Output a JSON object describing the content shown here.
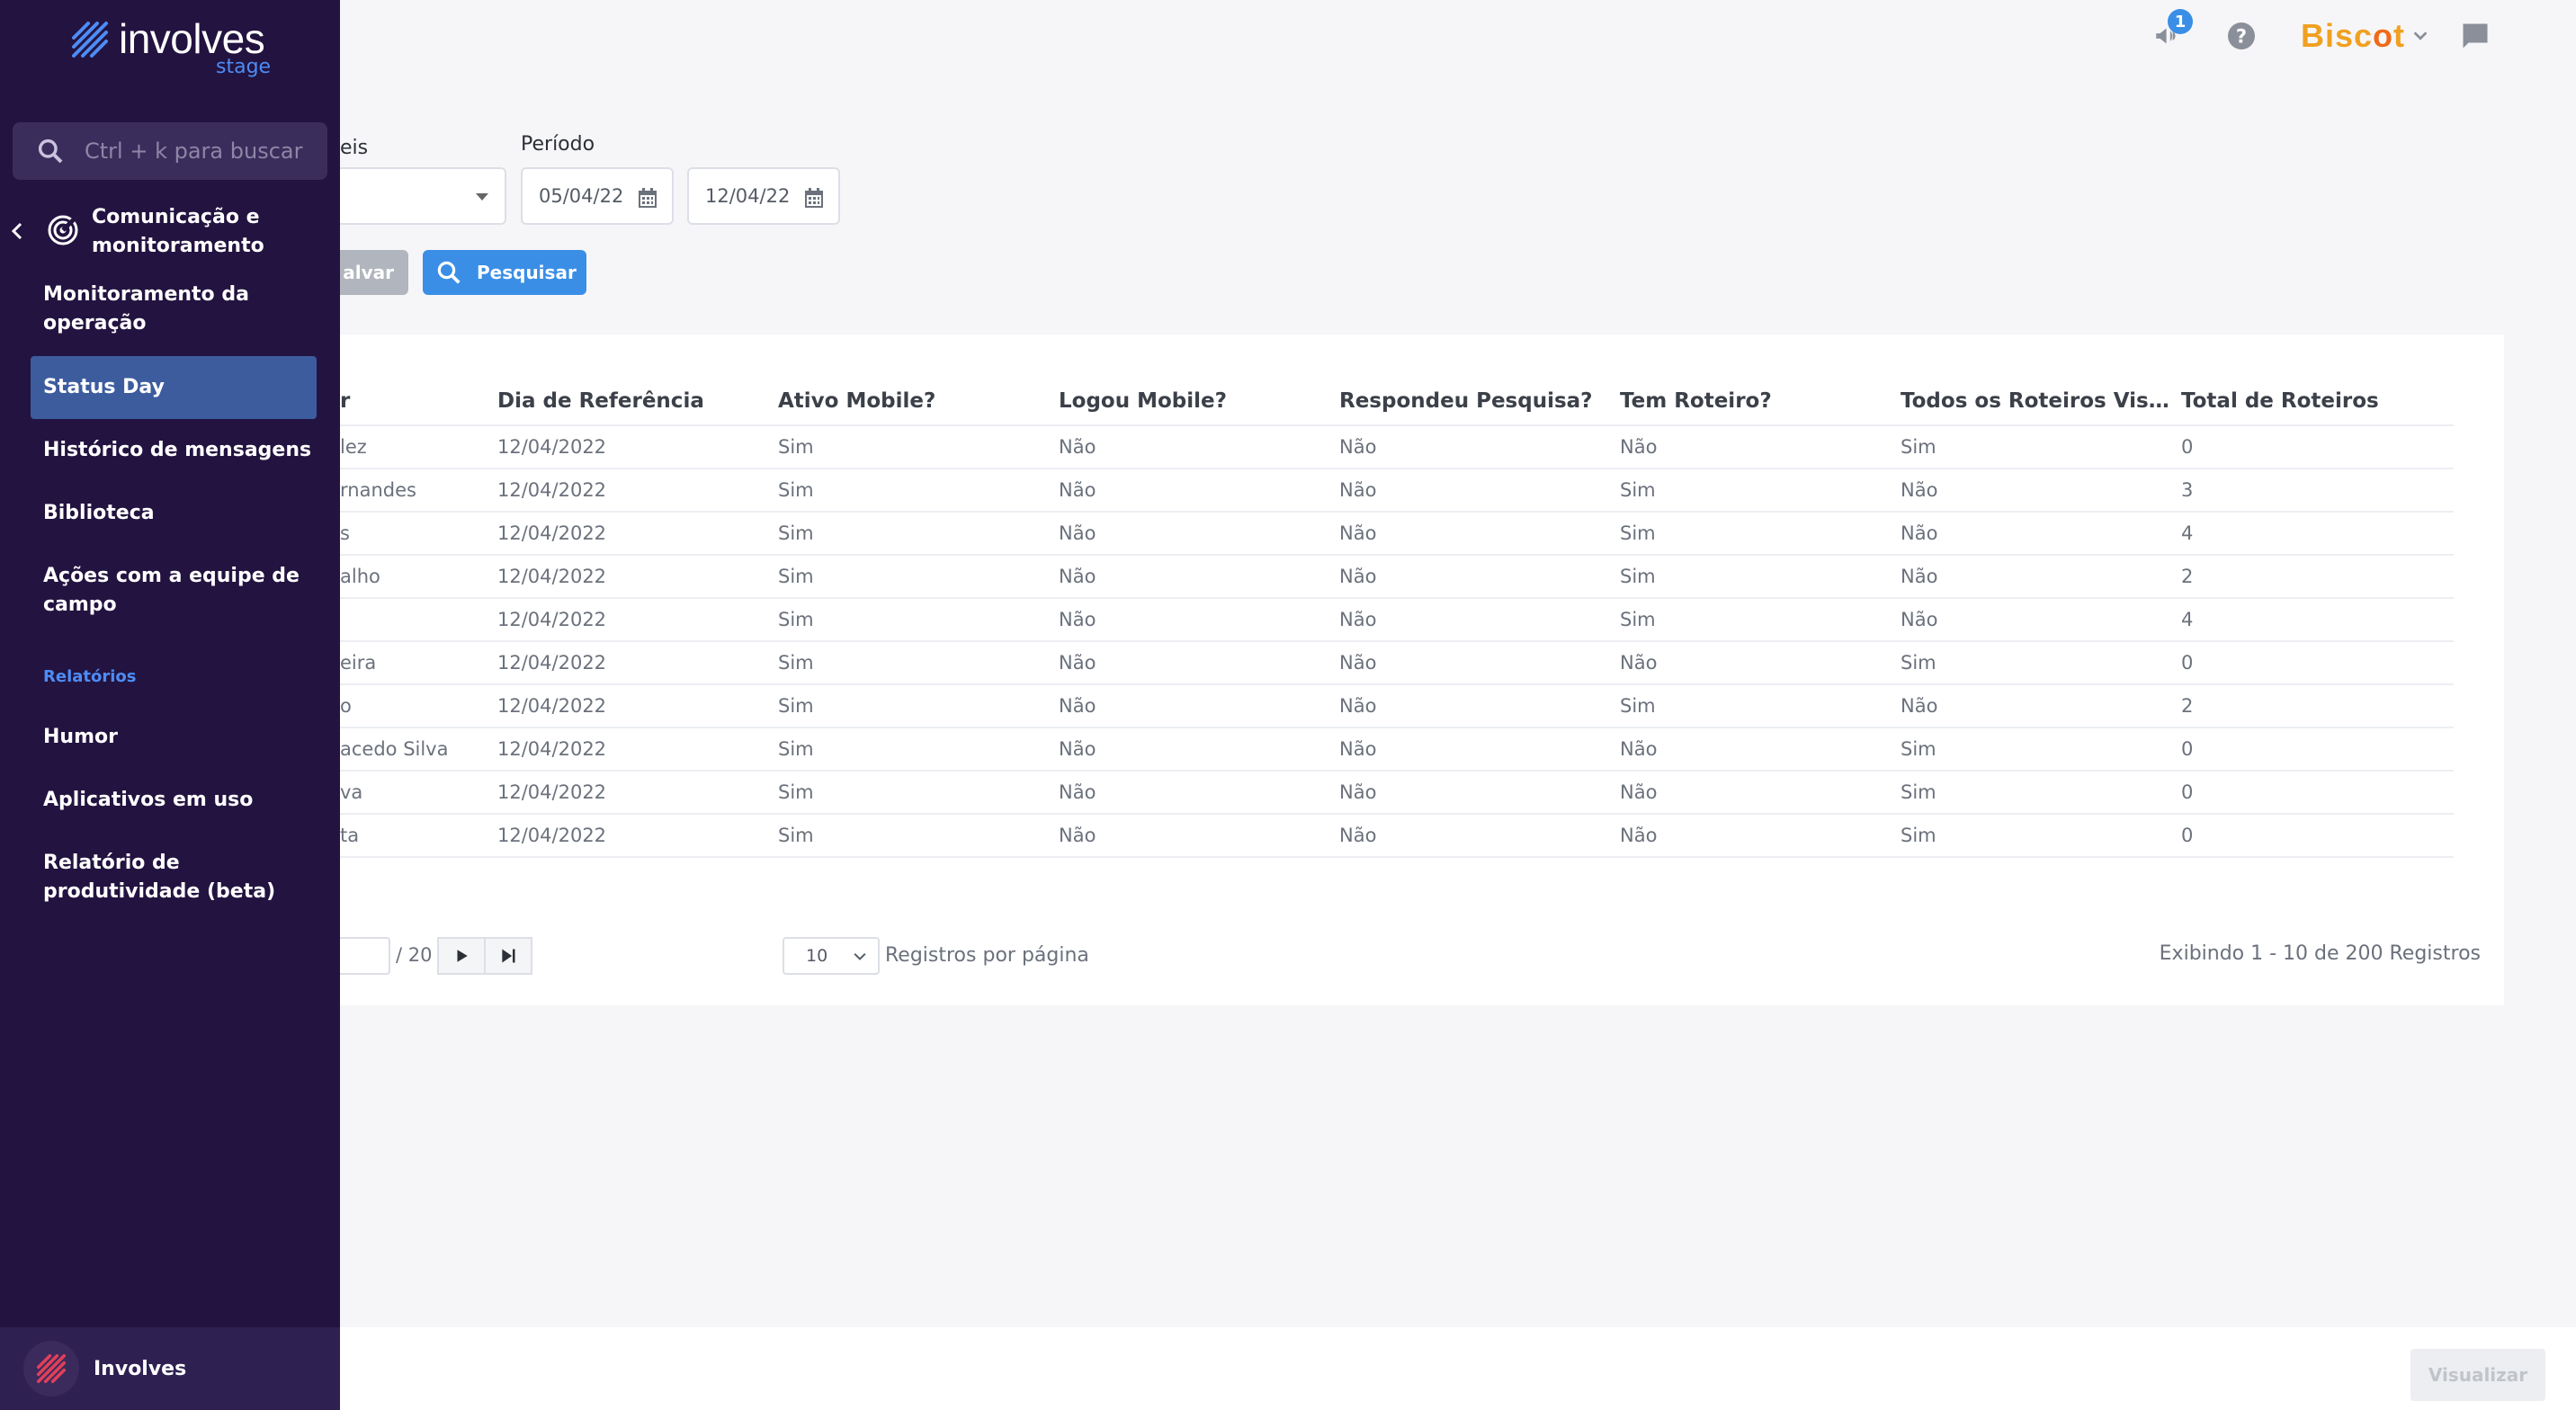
{
  "brand": {
    "name": "involves",
    "env": "stage",
    "accent": "#4d8cf5",
    "sidebar_bg": "#231340"
  },
  "topbar": {
    "notification_count": "1",
    "user_brand_a": "Bisc",
    "user_brand_b": "o",
    "user_brand_c": "t"
  },
  "sidebar": {
    "search_placeholder": "Ctrl + k para buscar",
    "section_title": "Comunicação e monitoramento",
    "items": [
      {
        "label": "Monitoramento da operação"
      },
      {
        "label": "Status Day",
        "active": true
      },
      {
        "label": "Histórico de mensagens"
      },
      {
        "label": "Biblioteca"
      },
      {
        "label": "Ações com a equipe de campo"
      }
    ],
    "group_label": "Relatórios",
    "report_items": [
      {
        "label": "Humor"
      },
      {
        "label": "Aplicativos em uso"
      },
      {
        "label": "Relatório de produtividade (beta)"
      }
    ],
    "org_name": "Involves"
  },
  "filters": {
    "select_label_fragment": "eis",
    "period_label": "Período",
    "start_date": "05/04/22",
    "end_date": "12/04/22",
    "save_label": "alvar",
    "search_label": "Pesquisar"
  },
  "table": {
    "headers": [
      "r",
      "Dia de Referência",
      "Ativo Mobile?",
      "Logou Mobile?",
      "Respondeu Pesquisa?",
      "Tem Roteiro?",
      "Todos os Roteiros Visita...",
      "Total de Roteiros"
    ],
    "rows": [
      [
        "lez",
        "12/04/2022",
        "Sim",
        "Não",
        "Não",
        "Não",
        "Sim",
        "0"
      ],
      [
        "rnandes",
        "12/04/2022",
        "Sim",
        "Não",
        "Não",
        "Sim",
        "Não",
        "3"
      ],
      [
        "s",
        "12/04/2022",
        "Sim",
        "Não",
        "Não",
        "Sim",
        "Não",
        "4"
      ],
      [
        "alho",
        "12/04/2022",
        "Sim",
        "Não",
        "Não",
        "Sim",
        "Não",
        "2"
      ],
      [
        "",
        "12/04/2022",
        "Sim",
        "Não",
        "Não",
        "Sim",
        "Não",
        "4"
      ],
      [
        "eira",
        "12/04/2022",
        "Sim",
        "Não",
        "Não",
        "Não",
        "Sim",
        "0"
      ],
      [
        "o",
        "12/04/2022",
        "Sim",
        "Não",
        "Não",
        "Sim",
        "Não",
        "2"
      ],
      [
        "acedo Silva",
        "12/04/2022",
        "Sim",
        "Não",
        "Não",
        "Não",
        "Sim",
        "0"
      ],
      [
        "va",
        "12/04/2022",
        "Sim",
        "Não",
        "Não",
        "Não",
        "Sim",
        "0"
      ],
      [
        "ta",
        "12/04/2022",
        "Sim",
        "Não",
        "Não",
        "Não",
        "Sim",
        "0"
      ]
    ]
  },
  "pagination": {
    "total_pages": "/ 20",
    "per_page": "10",
    "per_page_label": "Registros por página",
    "showing": "Exibindo 1 - 10 de 200 Registros"
  },
  "footer": {
    "view_label": "Visualizar"
  }
}
